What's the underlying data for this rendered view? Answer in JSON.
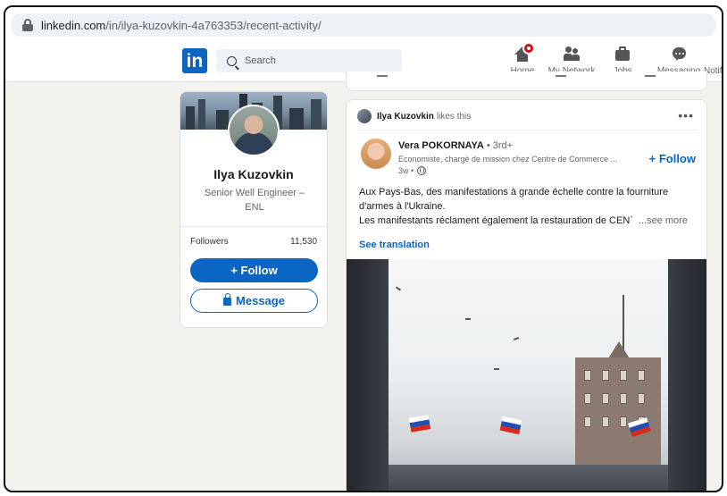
{
  "browser": {
    "url_host": "linkedin.com",
    "url_path": "/in/ilya-kuzovkin-4a763353/recent-activity/"
  },
  "nav": {
    "logo": "in",
    "search_placeholder": "Search",
    "items": [
      {
        "label": "Home",
        "icon": "home-icon"
      },
      {
        "label": "My Network",
        "icon": "network-icon"
      },
      {
        "label": "Jobs",
        "icon": "briefcase-icon"
      },
      {
        "label": "Messaging",
        "icon": "messaging-icon"
      },
      {
        "label": "Notif",
        "icon": "bell-icon"
      }
    ]
  },
  "profile": {
    "name": "Ilya Kuzovkin",
    "headline": "Senior Well Engineer – ENL",
    "followers_label": "Followers",
    "followers_count": "11,530",
    "follow_button": "+ Follow",
    "message_button": "Message"
  },
  "post": {
    "activity_actor": "Ilya Kuzovkin",
    "activity_text": "likes this",
    "more_menu": "•••",
    "author_name": "Vera POKORNAYA",
    "author_degree": " • 3rd+",
    "author_headline": "Economiste, chargé de mission chez Centre de Commerce ...",
    "timestamp": "3w •",
    "follow_label": "+ Follow",
    "text_lines": [
      "Aux Pays-Bas, des manifestations à grande échelle contre la fourniture",
      "d'armes à l'Ukraine.",
      "Les manifestants réclament également la restauration de CEN`"
    ],
    "see_more": "...see more",
    "see_translation": "See translation"
  },
  "colors": {
    "brand_blue": "#0a66c2",
    "page_bg": "#f4f2ee",
    "notification_red": "#cc1016"
  }
}
